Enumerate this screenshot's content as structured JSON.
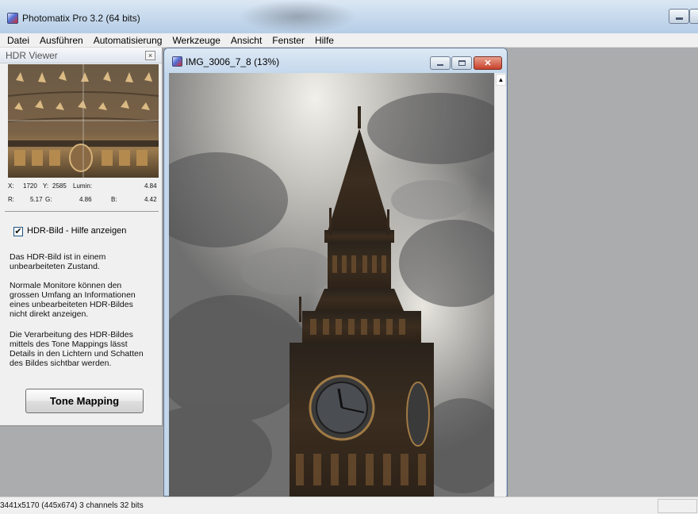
{
  "window": {
    "title": "Photomatix Pro 3.2 (64 bits)"
  },
  "menu": [
    "Datei",
    "Ausführen",
    "Automatisierung",
    "Werkzeuge",
    "Ansicht",
    "Fenster",
    "Hilfe"
  ],
  "viewer": {
    "title": "HDR Viewer",
    "readout": {
      "x_label": "X:",
      "x": "1720",
      "y_label": "Y:",
      "y": "2585",
      "lum_label": "Lumin:",
      "lum": "4.84",
      "r_label": "R:",
      "r": "5.17",
      "g_label": "G:",
      "g": "4.86",
      "b_label": "B:",
      "b": "4.42"
    },
    "checkbox_checked": true,
    "checkbox_label": "HDR-Bild  - Hilfe anzeigen",
    "help_lines": [
      "Das HDR-Bild ist in einem",
      "unbearbeiteten Zustand.",
      "Normale Monitore können den",
      "grossen Umfang an Informationen",
      "eines unbearbeiteten HDR-Bildes",
      "nicht direkt anzeigen.",
      "Die Verarbeitung des HDR-Bildes",
      "mittels des Tone Mappings lässt",
      "Details in den Lichtern und Schatten",
      "des Bildes sichtbar werden."
    ],
    "tone_mapping_button": "Tone Mapping"
  },
  "image_window": {
    "title": "IMG_3006_7_8 (13%)"
  },
  "status_bar": {
    "text": "3441x5170 (445x674) 3 channels 32 bits"
  },
  "icons": {
    "app": "photomatix-app-icon",
    "minimize": "minimize-icon",
    "maximize": "maximize-icon",
    "close": "close-icon",
    "scroll_up": "scroll-up-arrow-icon"
  },
  "colors": {
    "workspace": "#abacae",
    "panel": "#f0f0f0",
    "close_button": "#c7402a"
  }
}
